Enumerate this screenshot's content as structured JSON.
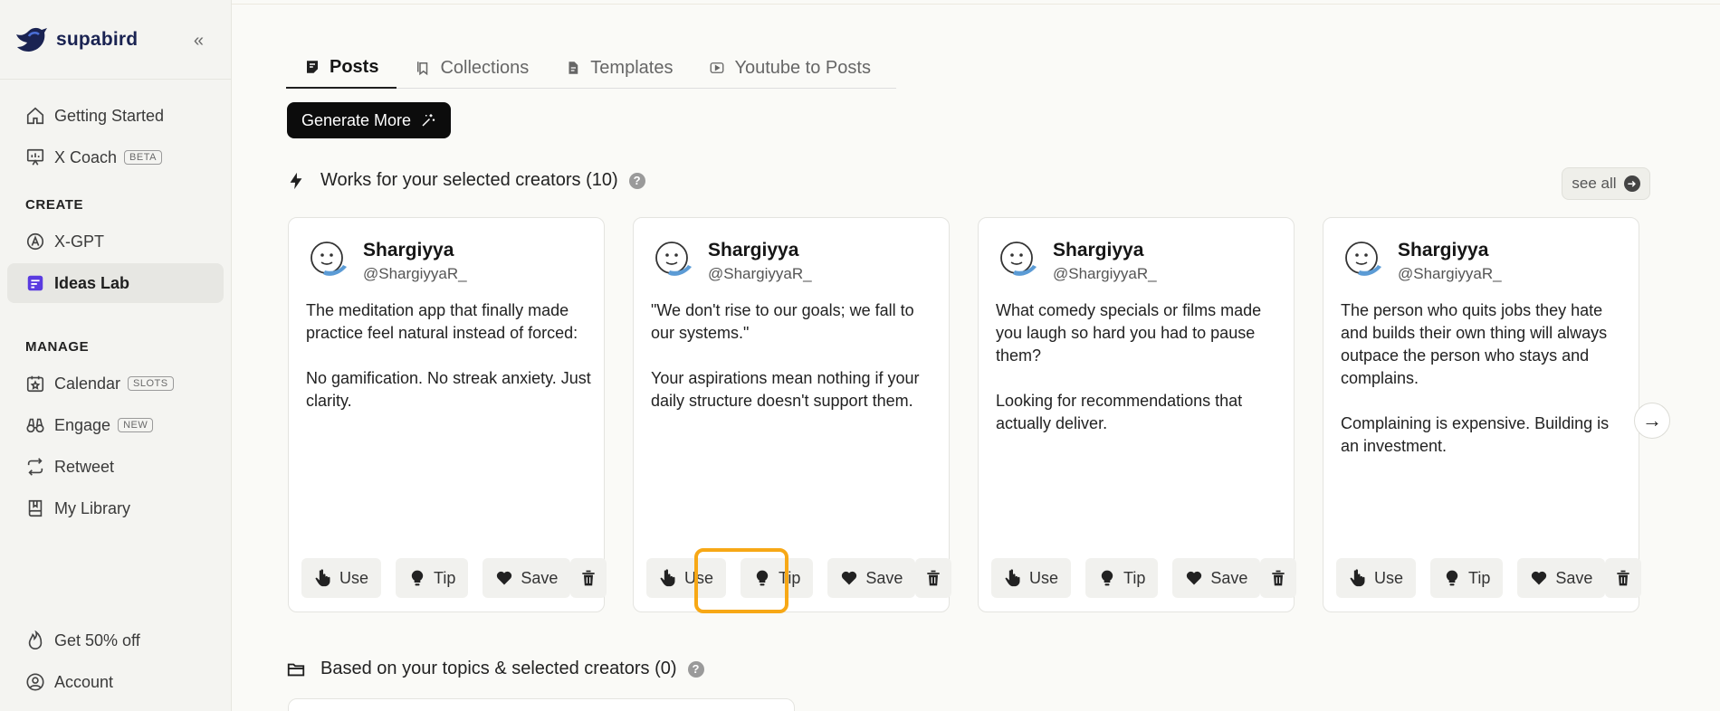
{
  "brand": {
    "name": "supabird",
    "collapse_icon": "double-chevron-left-icon"
  },
  "sidebar": {
    "top_items": [
      {
        "label": "Getting Started",
        "icon": "home-icon"
      },
      {
        "label": "X Coach",
        "icon": "presentation-icon",
        "badge": "BETA"
      }
    ],
    "create_title": "CREATE",
    "create_items": [
      {
        "label": "X-GPT",
        "icon": "x-gpt-icon"
      },
      {
        "label": "Ideas Lab",
        "icon": "ideas-lab-icon",
        "active": true
      }
    ],
    "manage_title": "MANAGE",
    "manage_items": [
      {
        "label": "Calendar",
        "icon": "calendar-icon",
        "badge": "SLOTS"
      },
      {
        "label": "Engage",
        "icon": "binoculars-icon",
        "badge": "NEW"
      },
      {
        "label": "Retweet",
        "icon": "retweet-icon"
      },
      {
        "label": "My Library",
        "icon": "library-icon"
      }
    ],
    "bottom_items": [
      {
        "label": "Get 50% off",
        "icon": "flame-icon"
      },
      {
        "label": "Account",
        "icon": "user-circle-icon"
      }
    ]
  },
  "tabs": [
    {
      "label": "Posts",
      "active": true
    },
    {
      "label": "Collections"
    },
    {
      "label": "Templates"
    },
    {
      "label": "Youtube to Posts"
    }
  ],
  "generate_button": "Generate More",
  "section1": {
    "title": "Works for your selected creators (10)",
    "see_all": "see all"
  },
  "section2": {
    "title": "Based on your topics & selected creators (0)"
  },
  "cards": [
    {
      "name": "Shargiyya",
      "handle": "@ShargiyyaR_",
      "text": "The meditation app that finally made practice feel natural instead of forced:\n\nNo gamification. No streak anxiety. Just clarity."
    },
    {
      "name": "Shargiyya",
      "handle": "@ShargiyyaR_",
      "text": "\"We don't rise to our goals; we fall to our systems.\"\n\nYour aspirations mean nothing if your daily structure doesn't support them."
    },
    {
      "name": "Shargiyya",
      "handle": "@ShargiyyaR_",
      "text": "What comedy specials or films made you laugh so hard you had to pause them?\n\nLooking for recommendations that actually deliver."
    },
    {
      "name": "Shargiyya",
      "handle": "@ShargiyyaR_",
      "text": "The person who quits jobs they hate and builds their own thing will always outpace the person who stays and complains.\n\nComplaining is expensive. Building is an investment."
    }
  ],
  "card_actions": {
    "use": "Use",
    "tip": "Tip",
    "save": "Save"
  },
  "colors": {
    "accent_highlight": "#f7a816",
    "brand_navy": "#1a2352",
    "primary_button": "#0c0c0c"
  }
}
